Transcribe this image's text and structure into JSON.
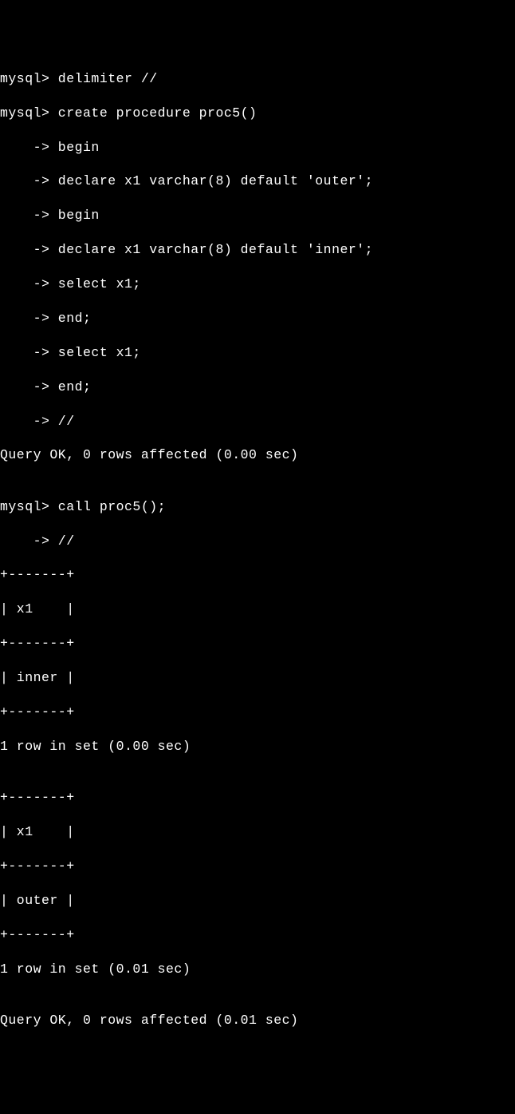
{
  "lines": {
    "l1": "mysql> delimiter //",
    "l2": "mysql> create procedure proc5()",
    "l3": "    -> begin",
    "l4": "    -> declare x1 varchar(8) default 'outer';",
    "l5": "    -> begin",
    "l6": "    -> declare x1 varchar(8) default 'inner';",
    "l7": "    -> select x1;",
    "l8": "    -> end;",
    "l9": "    -> select x1;",
    "l10": "    -> end;",
    "l11": "    -> //",
    "l12": "Query OK, 0 rows affected (0.00 sec)",
    "l13": "",
    "l14": "mysql> call proc5();",
    "l15": "    -> //",
    "l16": "+-------+",
    "l17": "| x1    |",
    "l18": "+-------+",
    "l19": "| inner |",
    "l20": "+-------+",
    "l21": "1 row in set (0.00 sec)",
    "l22": "",
    "l23": "+-------+",
    "l24": "| x1    |",
    "l25": "+-------+",
    "l26": "| outer |",
    "l27": "+-------+",
    "l28": "1 row in set (0.01 sec)",
    "l29": "",
    "l30": "Query OK, 0 rows affected (0.01 sec)"
  }
}
